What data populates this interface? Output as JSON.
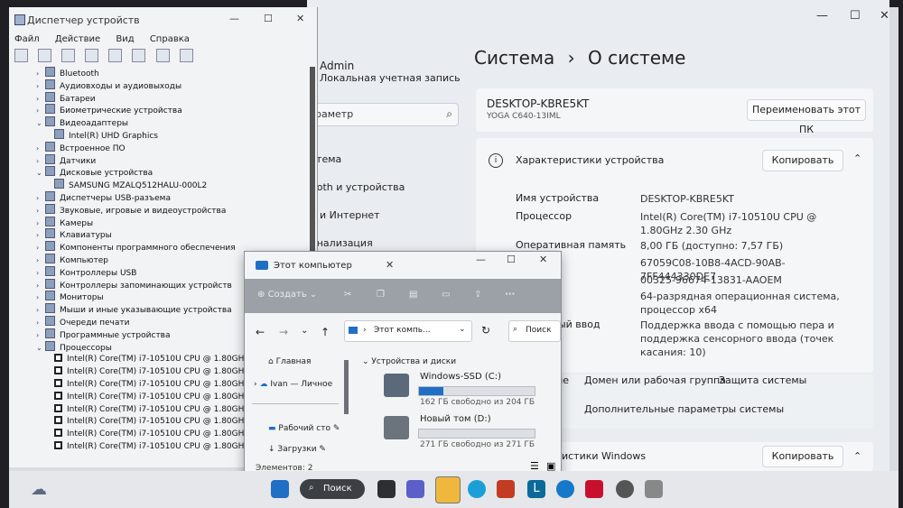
{
  "settings": {
    "user_name": "Admin",
    "user_sub": "Локальная учетная запись",
    "search_placeholder": "раметр",
    "nav": [
      "стема",
      "ooth и устройства",
      "ь и Интернет",
      "онализация"
    ],
    "breadcrumb_parent": "Система",
    "breadcrumb_sep": "›",
    "breadcrumb_current": "О системе",
    "device_name": "DESKTOP-KBRE5KT",
    "device_model": "YOGA C640-13IML",
    "rename_button": "Переименовать этот ПК",
    "specs_header": "Характеристики устройства",
    "copy_button": "Копировать",
    "specs": [
      {
        "label": "Имя устройства",
        "value": "DESKTOP-KBRE5KT"
      },
      {
        "label": "Процессор",
        "value": "Intel(R) Core(TM) i7-10510U CPU @ 1.80GHz   2.30 GHz"
      },
      {
        "label": "Оперативная память",
        "value": "8,00 ГБ (доступно: 7,57 ГБ)"
      },
      {
        "label": "ройства",
        "value": "67059C08-10B8-4ACD-90AB-7FF444330DE7"
      },
      {
        "label": "родукта",
        "value": "00325-96674-13831-AAOEM"
      },
      {
        "label": "истемы",
        "value": "64-разрядная операционная система, процессор x64"
      },
      {
        "label": "сенсорный ввод",
        "value": "Поддержка ввода с помощью пера и поддержка сенсорного ввода (точек касания: 10)"
      }
    ],
    "links_row": [
      "ме",
      "Домен или рабочая группа",
      "Защита системы"
    ],
    "advanced_link": "Дополнительные параметры системы",
    "win_specs": "ристики Windows",
    "copy_button2": "Копировать"
  },
  "devmgr": {
    "title": "Диспетчер устройств",
    "menu": [
      "Файл",
      "Действие",
      "Вид",
      "Справка"
    ],
    "tree": [
      {
        "label": "Bluetooth",
        "expanded": false,
        "level": 0
      },
      {
        "label": "Аудиовходы и аудиовыходы",
        "expanded": false,
        "level": 0
      },
      {
        "label": "Батареи",
        "expanded": false,
        "level": 0
      },
      {
        "label": "Биометрические устройства",
        "expanded": false,
        "level": 0
      },
      {
        "label": "Видеоадаптеры",
        "expanded": true,
        "level": 0
      },
      {
        "label": "Intel(R) UHD Graphics",
        "level": 1
      },
      {
        "label": "Встроенное ПО",
        "expanded": false,
        "level": 0
      },
      {
        "label": "Датчики",
        "expanded": false,
        "level": 0
      },
      {
        "label": "Дисковые устройства",
        "expanded": true,
        "level": 0
      },
      {
        "label": "SAMSUNG MZALQ512HALU-000L2",
        "level": 1
      },
      {
        "label": "Диспетчеры USB-разъема",
        "expanded": false,
        "level": 0
      },
      {
        "label": "Звуковые, игровые и видеоустройства",
        "expanded": false,
        "level": 0
      },
      {
        "label": "Камеры",
        "expanded": false,
        "level": 0
      },
      {
        "label": "Клавиатуры",
        "expanded": false,
        "level": 0
      },
      {
        "label": "Компоненты программного обеспечения",
        "expanded": false,
        "level": 0
      },
      {
        "label": "Компьютер",
        "expanded": false,
        "level": 0
      },
      {
        "label": "Контроллеры USB",
        "expanded": false,
        "level": 0
      },
      {
        "label": "Контроллеры запоминающих устройств",
        "expanded": false,
        "level": 0
      },
      {
        "label": "Мониторы",
        "expanded": false,
        "level": 0
      },
      {
        "label": "Мыши и иные указывающие устройства",
        "expanded": false,
        "level": 0
      },
      {
        "label": "Очереди печати",
        "expanded": false,
        "level": 0
      },
      {
        "label": "Программные устройства",
        "expanded": false,
        "level": 0
      },
      {
        "label": "Процессоры",
        "expanded": true,
        "level": 0
      },
      {
        "label": "Intel(R) Core(TM) i7-10510U CPU @ 1.80GHz",
        "level": 1,
        "cpu": true
      },
      {
        "label": "Intel(R) Core(TM) i7-10510U CPU @ 1.80GHz",
        "level": 1,
        "cpu": true
      },
      {
        "label": "Intel(R) Core(TM) i7-10510U CPU @ 1.80GHz",
        "level": 1,
        "cpu": true
      },
      {
        "label": "Intel(R) Core(TM) i7-10510U CPU @ 1.80GHz",
        "level": 1,
        "cpu": true
      },
      {
        "label": "Intel(R) Core(TM) i7-10510U CPU @ 1.80GHz",
        "level": 1,
        "cpu": true
      },
      {
        "label": "Intel(R) Core(TM) i7-10510U CPU @ 1.80GHz",
        "level": 1,
        "cpu": true
      },
      {
        "label": "Intel(R) Core(TM) i7-10510U CPU @ 1.80GHz",
        "level": 1,
        "cpu": true
      },
      {
        "label": "Intel(R) Core(TM) i7-10510U CPU @ 1.80GHz",
        "level": 1,
        "cpu": true
      }
    ]
  },
  "explorer": {
    "title": "Этот компьютер",
    "create": "Создать",
    "address": "Этот компь...",
    "search": "Поиск",
    "nav": [
      "Главная",
      "Ivan — Личное",
      "Рабочий сто",
      "Загрузки"
    ],
    "section": "Устройства и диски",
    "drives": [
      {
        "name": "Windows-SSD (C:)",
        "free": "162 ГБ свободно из 204 ГБ",
        "used_fraction": 0.21
      },
      {
        "name": "Новый том (D:)",
        "free": "271 ГБ свободно из 271 ГБ",
        "used_fraction": 0.0
      }
    ],
    "status": "Элементов: 2"
  },
  "taskbar": {
    "search": "Поиск"
  },
  "colors": {
    "accent": "#1f6fc5",
    "mcafee": "#c8102e"
  }
}
